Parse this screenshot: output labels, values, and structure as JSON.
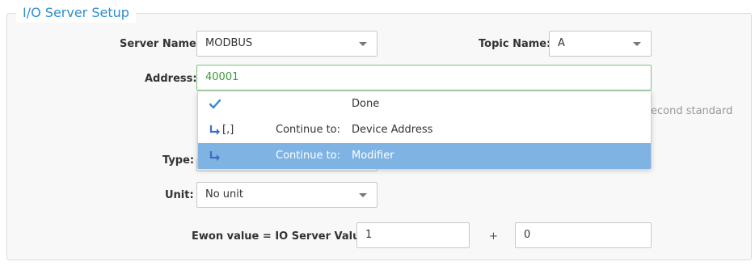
{
  "section": {
    "title": "I/O Server Setup"
  },
  "form": {
    "server_name": {
      "label": "Server Name:",
      "value": "MODBUS"
    },
    "topic_name": {
      "label": "Topic Name:",
      "value": "A"
    },
    "address": {
      "label": "Address:",
      "value": "40001"
    },
    "address_help_partial": "econd standard",
    "type": {
      "label": "Type:"
    },
    "unit": {
      "label": "Unit:",
      "value": "No unit"
    },
    "scale": {
      "label": "Ewon value = IO Server Value *",
      "multiplier": "1",
      "plus": "+",
      "offset": "0"
    }
  },
  "autocomplete": {
    "items": [
      {
        "icon": "check-icon",
        "keyword": "",
        "continue": "",
        "target": "Done",
        "selected": false
      },
      {
        "icon": "arrow-continue-icon",
        "keyword": "[,]",
        "continue": "Continue to:",
        "target": "Device Address",
        "selected": false
      },
      {
        "icon": "arrow-continue-icon",
        "keyword": "",
        "continue": "Continue to:",
        "target": "Modifier",
        "selected": true
      }
    ]
  },
  "colors": {
    "accent": "#2d8fd0",
    "selected_row": "#7fb3e3",
    "active_border": "#7fc07f"
  }
}
